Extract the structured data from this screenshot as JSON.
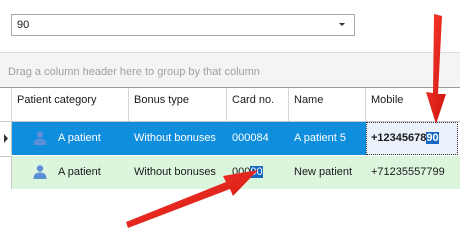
{
  "filter": {
    "value": "90"
  },
  "group_hint": "Drag a column header here to group by that column",
  "columns": {
    "patient_category": "Patient category",
    "bonus_type": "Bonus type",
    "card_no": "Card no.",
    "name": "Name",
    "mobile": "Mobile"
  },
  "rows": [
    {
      "patient_category": "A patient",
      "bonus_type": "Without bonuses",
      "card_no": "000084",
      "name": "A patient 5",
      "mobile_prefix": "+12345678",
      "mobile_match": "90"
    },
    {
      "patient_category": "A patient",
      "bonus_type": "Without bonuses",
      "card_no_prefix": "000",
      "card_no_match": "90",
      "name": "New patient",
      "mobile": "+71235557799"
    }
  ],
  "colors": {
    "selected_row": "#0f8ede",
    "second_row": "#dcf5dd",
    "match_highlight": "#1468c4",
    "arrow": "#e8201a"
  },
  "icons": [
    "chevron-down-icon",
    "row-pointer-icon",
    "person-icon",
    "arrow-pointer"
  ]
}
